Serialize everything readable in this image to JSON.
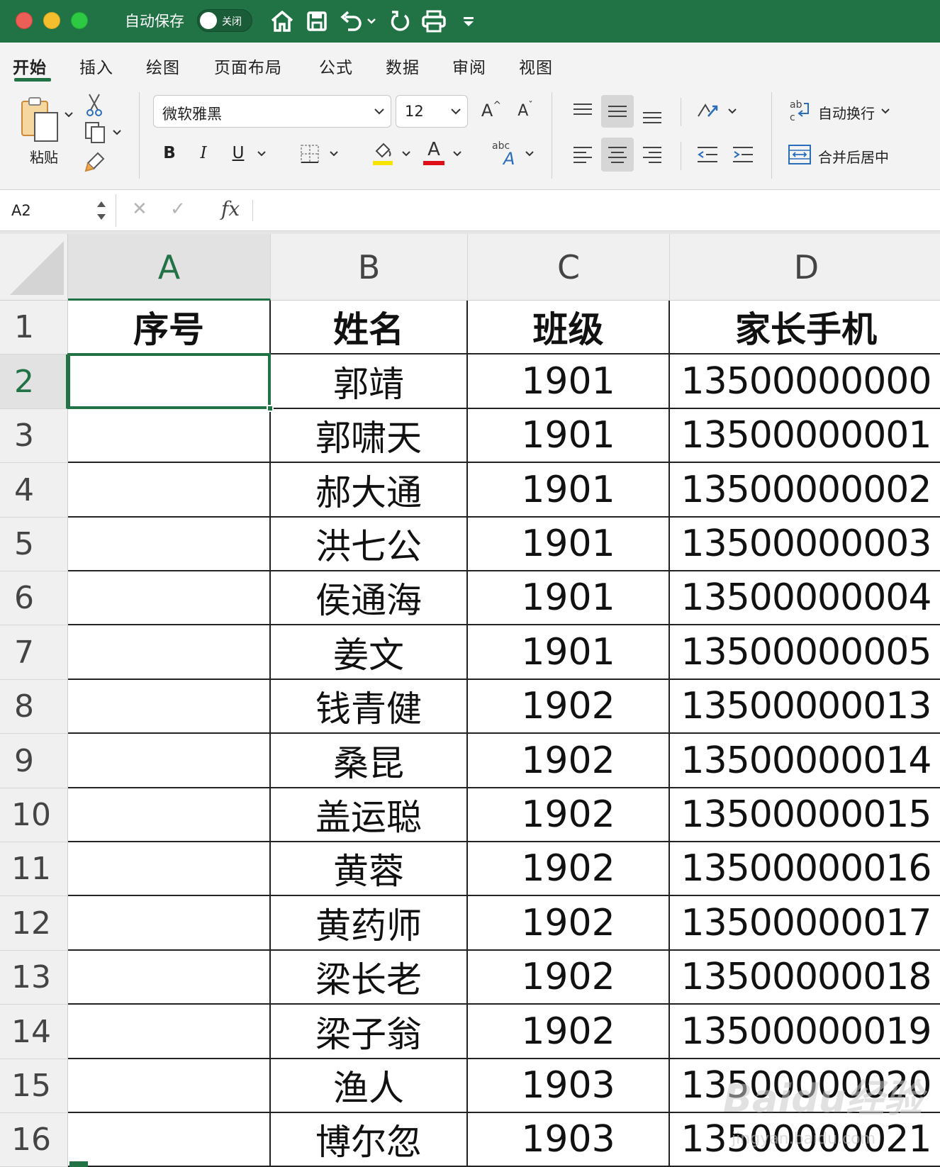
{
  "titlebar": {
    "autosave_label": "自动保存",
    "autosave_state": "关闭",
    "icons": [
      "home-icon",
      "save-icon",
      "undo-icon",
      "redo-icon",
      "print-icon",
      "customize-icon"
    ]
  },
  "tabs": [
    {
      "label": "开始",
      "active": true
    },
    {
      "label": "插入"
    },
    {
      "label": "绘图"
    },
    {
      "label": "页面布局"
    },
    {
      "label": "公式"
    },
    {
      "label": "数据"
    },
    {
      "label": "审阅"
    },
    {
      "label": "视图"
    }
  ],
  "ribbon": {
    "paste_label": "粘贴",
    "font_name": "微软雅黑",
    "font_size": "12",
    "bold": "B",
    "italic": "I",
    "underline": "U",
    "grow_font": "A",
    "shrink_font": "A",
    "font_color_letter": "A",
    "phonetic_abc": "abc",
    "phonetic_a": "A",
    "wrap_text_label": "自动换行",
    "merge_center_label": "合并后居中",
    "highlight_color": "#f7e500",
    "font_color": "#e0101b"
  },
  "formula_bar": {
    "name_box": "A2",
    "fx": "fx",
    "cancel": "✕",
    "enter": "✓"
  },
  "sheet": {
    "columns": [
      "A",
      "B",
      "C",
      "D"
    ],
    "selected_column": "A",
    "selected_row": "2",
    "selected_cell": "A2",
    "header": {
      "a": "序号",
      "b": "姓名",
      "c": "班级",
      "d": "家长手机"
    },
    "rows": [
      {
        "num": "1"
      },
      {
        "num": "2",
        "name": "郭靖",
        "cls": "1901",
        "phone": "13500000000"
      },
      {
        "num": "3",
        "name": "郭啸天",
        "cls": "1901",
        "phone": "13500000001"
      },
      {
        "num": "4",
        "name": "郝大通",
        "cls": "1901",
        "phone": "13500000002"
      },
      {
        "num": "5",
        "name": "洪七公",
        "cls": "1901",
        "phone": "13500000003"
      },
      {
        "num": "6",
        "name": "侯通海",
        "cls": "1901",
        "phone": "13500000004"
      },
      {
        "num": "7",
        "name": "姜文",
        "cls": "1901",
        "phone": "13500000005"
      },
      {
        "num": "8",
        "name": "钱青健",
        "cls": "1902",
        "phone": "13500000013"
      },
      {
        "num": "9",
        "name": "桑昆",
        "cls": "1902",
        "phone": "13500000014"
      },
      {
        "num": "10",
        "name": "盖运聪",
        "cls": "1902",
        "phone": "13500000015"
      },
      {
        "num": "11",
        "name": "黄蓉",
        "cls": "1902",
        "phone": "13500000016"
      },
      {
        "num": "12",
        "name": "黄药师",
        "cls": "1902",
        "phone": "13500000017"
      },
      {
        "num": "13",
        "name": "梁长老",
        "cls": "1902",
        "phone": "13500000018"
      },
      {
        "num": "14",
        "name": "梁子翁",
        "cls": "1902",
        "phone": "13500000019"
      },
      {
        "num": "15",
        "name": "渔人",
        "cls": "1903",
        "phone": "13500000020"
      },
      {
        "num": "16",
        "name": "博尔忽",
        "cls": "1903",
        "phone": "13500000021"
      }
    ]
  },
  "watermark": {
    "main": "Baidu经验",
    "sub": "jingyan.baidu.com"
  }
}
